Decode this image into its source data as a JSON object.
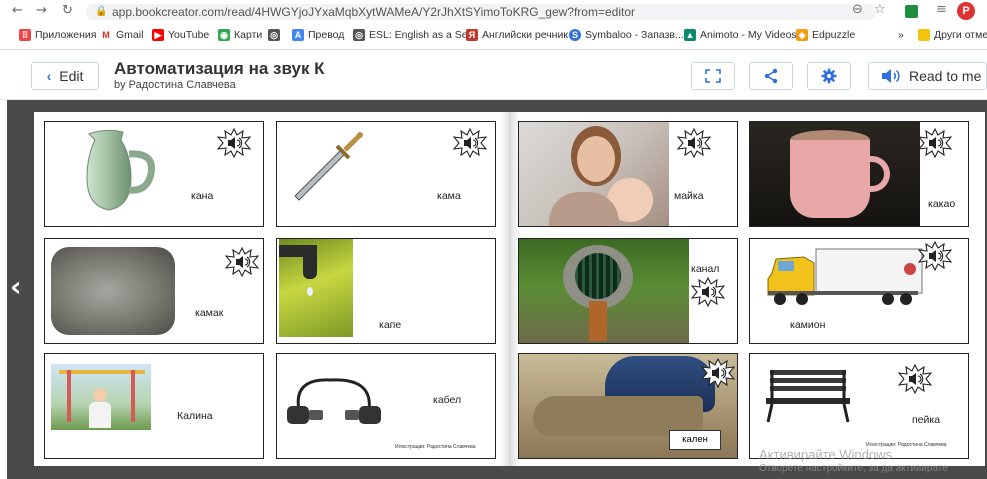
{
  "browser": {
    "url": "app.bookcreator.com/read/4HWGYjoJYxaMqbXytWAMeA/Y2rJhXtSYimoToKRG_gew?from=editor",
    "bookmarks": [
      {
        "label": "Приложения",
        "icon": "apps-icon",
        "color": "#e44"
      },
      {
        "label": "Gmail",
        "icon": "gmail-icon",
        "color": "#d93025"
      },
      {
        "label": "YouTube",
        "icon": "youtube-icon",
        "color": "#ff0000"
      },
      {
        "label": "Карти",
        "icon": "maps-icon",
        "color": "#34a853"
      },
      {
        "label": "Превод",
        "icon": "translate-icon",
        "color": "#555"
      },
      {
        "label": "ESL: English as a Se...",
        "icon": "globe-icon",
        "color": "#555"
      },
      {
        "label": "Английски речник",
        "icon": "dictionary-icon",
        "color": "#c0392b"
      },
      {
        "label": "Symbaloo - Запазв...",
        "icon": "symbaloo-icon",
        "color": "#2f6fde"
      },
      {
        "label": "Animoto - My Videos",
        "icon": "animoto-icon",
        "color": "#0a8a6a"
      },
      {
        "label": "Edpuzzle",
        "icon": "edpuzzle-icon",
        "color": "#f39c12"
      },
      {
        "label": "»",
        "icon": "more-icon",
        "color": "#555"
      },
      {
        "label": "Други отмет",
        "icon": "folder-icon",
        "color": "#f1c40f"
      }
    ],
    "profile_initial": "P"
  },
  "header": {
    "edit_label": "Edit",
    "title": "Автоматизация на звук К",
    "author": "by Радостина Славчева",
    "read_label": "Read to me",
    "accent": "#2f6fde"
  },
  "cards": [
    {
      "word": "кана",
      "image": "green-jug"
    },
    {
      "word": "кама",
      "image": "dagger"
    },
    {
      "word": "майка",
      "image": "mother-child"
    },
    {
      "word": "какао",
      "image": "cocoa-mug"
    },
    {
      "word": "камак",
      "image": "stone"
    },
    {
      "word": "капе",
      "image": "dripping-tap"
    },
    {
      "word": "канал",
      "image": "drain-pipe"
    },
    {
      "word": "камион",
      "image": "truck"
    },
    {
      "word": "Калина",
      "image": "girl-playground"
    },
    {
      "word": "кабел",
      "image": "cable"
    },
    {
      "word": "кален",
      "image": "muddy-shoe"
    },
    {
      "word": "пейка",
      "image": "bench"
    }
  ],
  "credits": [
    "Илюстрации: Радостина Славчева",
    "Илюстрации: Радостина Славчева"
  ],
  "watermark": {
    "line1": "Активирайте Windows",
    "line2": "Отворете настройките, за да активирате"
  }
}
